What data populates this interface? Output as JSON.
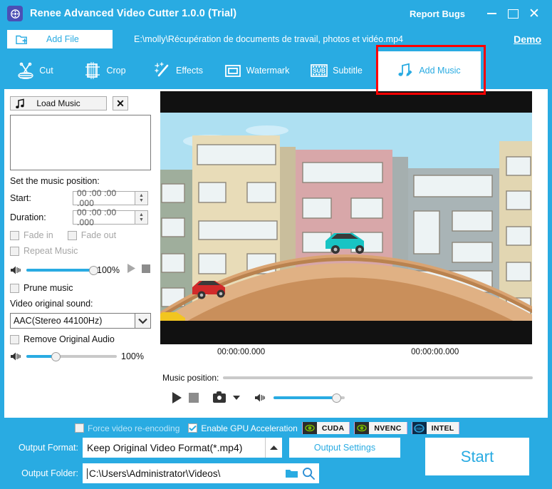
{
  "window": {
    "title": "Renee Advanced Video Cutter 1.0.0 (Trial)",
    "logo_icon": "film-reel-icon",
    "report_bugs": "Report Bugs",
    "minimize_icon": "minimize-icon",
    "maximize_icon": "maximize-icon",
    "close_icon": "close-icon",
    "accent": "#29ABE2"
  },
  "file_row": {
    "add_file_label": "Add File",
    "add_file_icon": "folder-add-icon",
    "file_path": "E:\\molly\\Récupération de documents de travail, photos et vidéo.mp4",
    "demo_label": "Demo"
  },
  "tabs": [
    {
      "label": "Cut",
      "icon": "scissors-icon",
      "active": false
    },
    {
      "label": "Crop",
      "icon": "film-frame-icon",
      "active": false
    },
    {
      "label": "Effects",
      "icon": "magic-wand-icon",
      "active": false
    },
    {
      "label": "Watermark",
      "icon": "watermark-frame-icon",
      "active": false
    },
    {
      "label": "Subtitle",
      "icon": "subtitle-film-icon",
      "active": false
    },
    {
      "label": "Add Music",
      "icon": "music-note-pencil-icon",
      "active": true
    }
  ],
  "left_panel": {
    "load_music_label": "Load Music",
    "load_music_icon": "music-note-icon",
    "clear_icon": "close-icon",
    "music_position_label": "Set the music position:",
    "start_label": "Start:",
    "start_value": "00 :00 :00 .000",
    "duration_label": "Duration:",
    "duration_value": "00 :00 :00 .000",
    "fade_in_label": "Fade in",
    "fade_in_checked": false,
    "fade_out_label": "Fade out",
    "fade_out_checked": false,
    "repeat_music_label": "Repeat Music",
    "repeat_music_checked": false,
    "music_volume_percent": "100%",
    "music_volume_fill": 100,
    "play_icon": "play-icon",
    "stop_icon": "stop-icon",
    "prune_music_label": "Prune music",
    "prune_music_checked": false,
    "video_sound_label": "Video original sound:",
    "video_sound_value": "AAC(Stereo 44100Hz)",
    "dropdown_icon": "chevron-down-icon",
    "remove_audio_label": "Remove Original Audio",
    "remove_audio_checked": false,
    "original_volume_percent": "100%",
    "original_volume_fill": 33,
    "volume_icon": "speaker-icon"
  },
  "player": {
    "time_current": "00:00:00.000",
    "time_total": "00:00:00.000",
    "music_position_label": "Music position:",
    "music_position_fill": 0,
    "play_icon": "play-icon",
    "stop_icon": "stop-icon",
    "snapshot_icon": "camera-icon",
    "snapshot_caret_icon": "caret-down-icon",
    "volume_icon": "speaker-icon",
    "volume_fill": 88
  },
  "bottom": {
    "force_reencode_label": "Force video re-encoding",
    "force_reencode_checked": false,
    "gpu_accel_label": "Enable GPU Acceleration",
    "gpu_accel_checked": true,
    "badges": [
      {
        "name": "CUDA",
        "logo": "nvidia-icon"
      },
      {
        "name": "NVENC",
        "logo": "nvidia-icon"
      },
      {
        "name": "INTEL",
        "logo": "intel-icon"
      }
    ],
    "output_format_label": "Output Format:",
    "output_format_value": "Keep Original Video Format(*.mp4)",
    "output_format_arrow_icon": "caret-up-icon",
    "output_settings_label": "Output Settings",
    "output_folder_label": "Output Folder:",
    "output_folder_value": "C:\\Users\\Administrator\\Videos\\",
    "folder_icon": "folder-icon",
    "search_icon": "search-icon",
    "start_label": "Start"
  },
  "annotation": {
    "highlight_color": "#FF0000",
    "target": "add-music-tab"
  }
}
